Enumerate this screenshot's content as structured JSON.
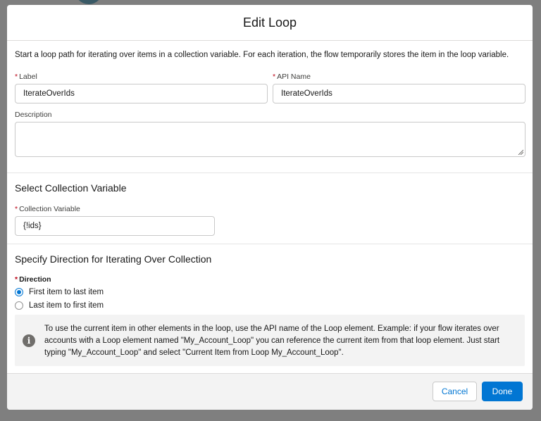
{
  "modal": {
    "title": "Edit Loop",
    "intro": "Start a loop path for iterating over items in a collection variable. For each iteration, the flow temporarily stores the item in the loop variable."
  },
  "fields": {
    "required_marker": "*",
    "label": {
      "label": "Label",
      "value": "IterateOverIds"
    },
    "api_name": {
      "label": "API Name",
      "value": "IterateOverIds"
    },
    "description": {
      "label": "Description",
      "value": ""
    }
  },
  "collection_section": {
    "title": "Select Collection Variable",
    "field_label": "Collection Variable",
    "value": "{!ids}"
  },
  "direction_section": {
    "title": "Specify Direction for Iterating Over Collection",
    "label": "Direction",
    "options": [
      {
        "label": "First item to last item",
        "selected": true
      },
      {
        "label": "Last item to first item",
        "selected": false
      }
    ]
  },
  "info": {
    "icon": "info-icon",
    "text": "To use the current item in other elements in the loop, use the API name of the Loop element. Example: if your flow iterates over accounts with a Loop element named \"My_Account_Loop\" you can reference the current item from that loop element. Just start typing \"My_Account_Loop\" and select \"Current Item from Loop My_Account_Loop\"."
  },
  "footer": {
    "cancel_label": "Cancel",
    "done_label": "Done"
  },
  "colors": {
    "brand": "#0176d3",
    "required": "#ba0517",
    "overlay": "#7f7f7f"
  }
}
